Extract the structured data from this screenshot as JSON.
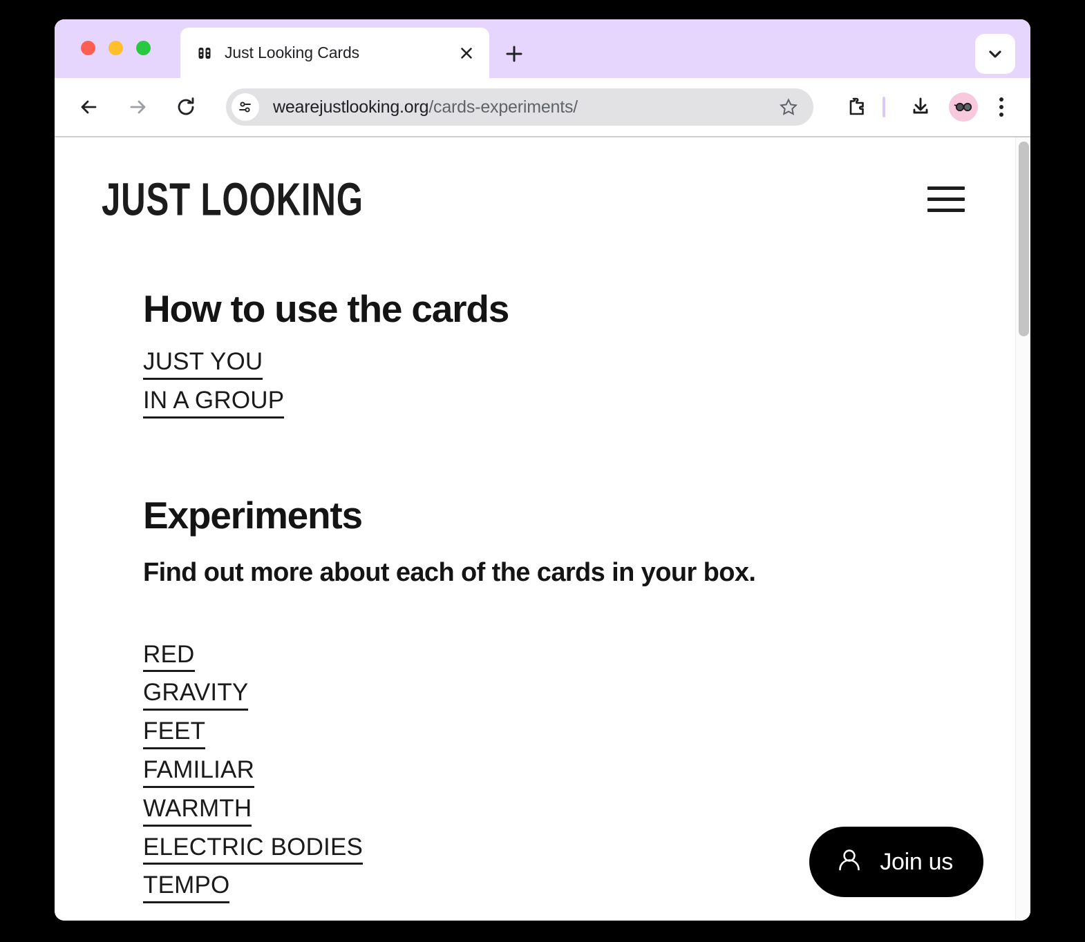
{
  "browser": {
    "window_controls": [
      "close",
      "minimize",
      "maximize"
    ],
    "tab": {
      "title": "Just Looking Cards",
      "favicon": "binoculars-icon",
      "close_label": "×"
    },
    "new_tab_label": "+",
    "tab_list_icon": "chevron-down-icon",
    "toolbar": {
      "back_icon": "back-arrow-icon",
      "forward_icon": "forward-arrow-icon",
      "reload_icon": "reload-icon",
      "site_info_icon": "tune-sliders-icon",
      "url_host": "wearejustlooking.org",
      "url_path": "/cards-experiments/",
      "bookmark_icon": "star-outline-icon",
      "extensions_icon": "puzzle-piece-icon",
      "downloads_icon": "download-icon",
      "avatar_icon": "sunglasses-avatar-icon",
      "menu_icon": "three-dot-menu-icon"
    },
    "colors": {
      "tabstrip": "#e6d6fd",
      "omnibox": "#e2e2e4",
      "avatar_bg": "#f8c8dc",
      "accent_divider": "#dcc9f5",
      "traffic_red": "#ff5f52",
      "traffic_yellow": "#ffbf2b",
      "traffic_green": "#28c840"
    }
  },
  "site": {
    "logo": "JUST LOOKING",
    "menu_icon": "hamburger-menu-icon",
    "sections": [
      {
        "heading": "How to use the cards",
        "links": [
          "JUST YOU",
          "IN A GROUP"
        ]
      },
      {
        "heading": "Experiments",
        "subheading": "Find out more about each of the cards in your box.",
        "links": [
          "RED",
          "GRAVITY",
          "FEET",
          "FAMILIAR",
          "WARMTH",
          "ELECTRIC BODIES",
          "TEMPO"
        ]
      }
    ],
    "join_button": {
      "label": "Join us",
      "icon": "person-icon",
      "bg": "#000000"
    }
  }
}
